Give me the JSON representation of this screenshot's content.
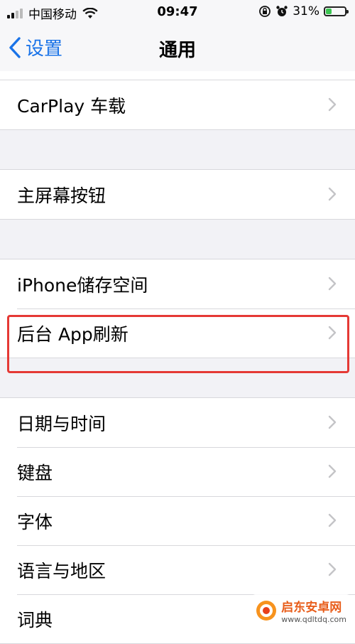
{
  "status_bar": {
    "carrier": "中国移动",
    "time": "09:47",
    "battery_percent": "31%",
    "battery_level": 0.31,
    "signal_bars": 4,
    "signal_active": 2
  },
  "nav": {
    "back_label": "设置",
    "title": "通用",
    "accent_color": "#1a73e8"
  },
  "groups": [
    {
      "items": [
        {
          "label": "CarPlay 车载"
        }
      ]
    },
    {
      "items": [
        {
          "label": "主屏幕按钮"
        }
      ]
    },
    {
      "items": [
        {
          "label": "iPhone储存空间"
        },
        {
          "label": "后台 App刷新"
        }
      ]
    },
    {
      "items": [
        {
          "label": "日期与时间",
          "highlighted": true
        },
        {
          "label": "键盘"
        },
        {
          "label": "字体"
        },
        {
          "label": "语言与地区"
        },
        {
          "label": "词典"
        }
      ]
    }
  ],
  "highlight_color": "#e53935",
  "watermark": {
    "name": "启东安卓网",
    "url": "www.qdltdq.com"
  }
}
